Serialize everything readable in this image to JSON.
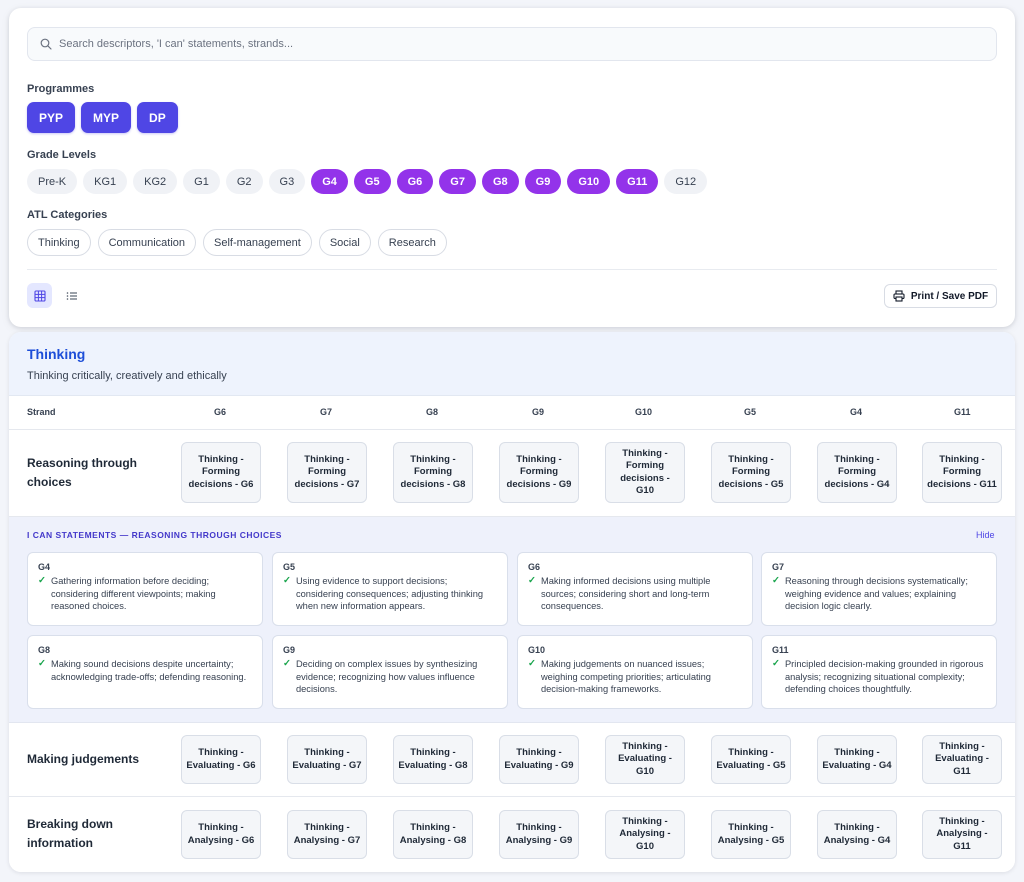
{
  "search": {
    "placeholder": "Search descriptors, 'I can' statements, strands..."
  },
  "programmes": {
    "label": "Programmes",
    "items": [
      "PYP",
      "MYP",
      "DP"
    ],
    "color": "#4f46e5"
  },
  "grades": {
    "label": "Grade Levels",
    "items": [
      "Pre-K",
      "KG1",
      "KG2",
      "G1",
      "G2",
      "G3",
      "G4",
      "G5",
      "G6",
      "G7",
      "G8",
      "G9",
      "G10",
      "G11",
      "G12"
    ],
    "selected": [
      "G4",
      "G5",
      "G6",
      "G7",
      "G8",
      "G9",
      "G10",
      "G11"
    ],
    "selected_color": "#9333ea"
  },
  "atl": {
    "label": "ATL Categories",
    "items": [
      "Thinking",
      "Communication",
      "Self-management",
      "Social",
      "Research"
    ]
  },
  "toolbar": {
    "grid_icon": "grid-icon",
    "list_icon": "list-icon",
    "print_label": "Print / Save PDF"
  },
  "category": {
    "title": "Thinking",
    "description": "Thinking critically, creatively and ethically",
    "title_color": "#1d4ed8"
  },
  "table": {
    "strand_header": "Strand",
    "columns": [
      "G6",
      "G7",
      "G8",
      "G9",
      "G10",
      "G5",
      "G4",
      "G11"
    ],
    "rows": [
      {
        "strand": "Reasoning through choices",
        "cells": [
          "Thinking - Forming decisions - G6",
          "Thinking - Forming decisions - G7",
          "Thinking - Forming decisions - G8",
          "Thinking - Forming decisions - G9",
          "Thinking - Forming decisions - G10",
          "Thinking - Forming decisions - G5",
          "Thinking - Forming decisions - G4",
          "Thinking - Forming decisions - G11"
        ]
      },
      {
        "strand": "Making judgements",
        "cells": [
          "Thinking - Evaluating - G6",
          "Thinking - Evaluating - G7",
          "Thinking - Evaluating - G8",
          "Thinking - Evaluating - G9",
          "Thinking - Evaluating - G10",
          "Thinking - Evaluating - G5",
          "Thinking - Evaluating - G4",
          "Thinking - Evaluating - G11"
        ]
      },
      {
        "strand": "Breaking down information",
        "cells": [
          "Thinking - Analysing - G6",
          "Thinking - Analysing - G7",
          "Thinking - Analysing - G8",
          "Thinking - Analysing - G9",
          "Thinking - Analysing - G10",
          "Thinking - Analysing - G5",
          "Thinking - Analysing - G4",
          "Thinking - Analysing - G11"
        ]
      }
    ]
  },
  "ican": {
    "title": "I CAN STATEMENTS — REASONING THROUGH CHOICES",
    "hide_label": "Hide",
    "check_icon": "check-icon",
    "cards": [
      {
        "grade": "G4",
        "text": "Gathering information before deciding; considering different viewpoints; making reasoned choices."
      },
      {
        "grade": "G5",
        "text": "Using evidence to support decisions; considering consequences; adjusting thinking when new information appears."
      },
      {
        "grade": "G6",
        "text": "Making informed decisions using multiple sources; considering short and long-term consequences."
      },
      {
        "grade": "G7",
        "text": "Reasoning through decisions systematically; weighing evidence and values; explaining decision logic clearly."
      },
      {
        "grade": "G8",
        "text": "Making sound decisions despite uncertainty; acknowledging trade-offs; defending reasoning."
      },
      {
        "grade": "G9",
        "text": "Deciding on complex issues by synthesizing evidence; recognizing how values influence decisions."
      },
      {
        "grade": "G10",
        "text": "Making judgements on nuanced issues; weighing competing priorities; articulating decision-making frameworks."
      },
      {
        "grade": "G11",
        "text": "Principled decision-making grounded in rigorous analysis; recognizing situational complexity; defending choices thoughtfully."
      }
    ]
  }
}
